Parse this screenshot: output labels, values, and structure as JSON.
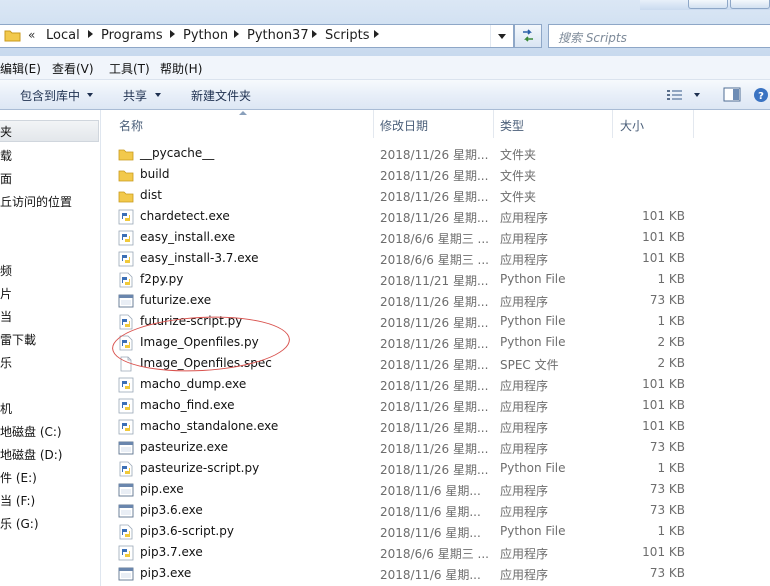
{
  "address": {
    "overflow": "«",
    "crumbs": [
      "Local",
      "Programs",
      "Python",
      "Python37",
      "Scripts"
    ]
  },
  "search": {
    "placeholder": "搜索 Scripts"
  },
  "menu": [
    "编辑(E)",
    "查看(V)",
    "工具(T)",
    "帮助(H)"
  ],
  "commands": {
    "include_library": "包含到库中",
    "share": "共享",
    "new_folder": "新建文件夹"
  },
  "nav": {
    "items": [
      "夹",
      "载",
      "面",
      "丘访问的位置",
      "频",
      "片",
      "当",
      "雷下載",
      "乐",
      "机",
      "地磁盘 (C:)",
      "地磁盘 (D:)",
      "件 (E:)",
      "当 (F:)",
      "乐 (G:)"
    ]
  },
  "columns": {
    "name": "名称",
    "date": "修改日期",
    "type": "类型",
    "size": "大小"
  },
  "files": [
    {
      "icon": "folder-icon",
      "name": "__pycache__",
      "date": "2018/11/26 星期...",
      "type": "文件夹",
      "size": ""
    },
    {
      "icon": "folder-icon",
      "name": "build",
      "date": "2018/11/26 星期...",
      "type": "文件夹",
      "size": ""
    },
    {
      "icon": "folder-icon",
      "name": "dist",
      "date": "2018/11/26 星期...",
      "type": "文件夹",
      "size": ""
    },
    {
      "icon": "python-exe-icon",
      "name": "chardetect.exe",
      "date": "2018/11/26 星期...",
      "type": "应用程序",
      "size": "101 KB"
    },
    {
      "icon": "python-exe-icon",
      "name": "easy_install.exe",
      "date": "2018/6/6 星期三 ...",
      "type": "应用程序",
      "size": "101 KB"
    },
    {
      "icon": "python-exe-icon",
      "name": "easy_install-3.7.exe",
      "date": "2018/6/6 星期三 ...",
      "type": "应用程序",
      "size": "101 KB"
    },
    {
      "icon": "python-file-icon",
      "name": "f2py.py",
      "date": "2018/11/21 星期...",
      "type": "Python File",
      "size": "1 KB"
    },
    {
      "icon": "app-exe-icon",
      "name": "futurize.exe",
      "date": "2018/11/26 星期...",
      "type": "应用程序",
      "size": "73 KB"
    },
    {
      "icon": "python-file-icon",
      "name": "futurize-script.py",
      "date": "2018/11/26 星期...",
      "type": "Python File",
      "size": "1 KB"
    },
    {
      "icon": "python-file-icon",
      "name": "Image_Openfiles.py",
      "date": "2018/11/26 星期...",
      "type": "Python File",
      "size": "2 KB"
    },
    {
      "icon": "blank-file-icon",
      "name": "Image_Openfiles.spec",
      "date": "2018/11/26 星期...",
      "type": "SPEC 文件",
      "size": "2 KB"
    },
    {
      "icon": "python-exe-icon",
      "name": "macho_dump.exe",
      "date": "2018/11/26 星期...",
      "type": "应用程序",
      "size": "101 KB"
    },
    {
      "icon": "python-exe-icon",
      "name": "macho_find.exe",
      "date": "2018/11/26 星期...",
      "type": "应用程序",
      "size": "101 KB"
    },
    {
      "icon": "python-exe-icon",
      "name": "macho_standalone.exe",
      "date": "2018/11/26 星期...",
      "type": "应用程序",
      "size": "101 KB"
    },
    {
      "icon": "app-exe-icon",
      "name": "pasteurize.exe",
      "date": "2018/11/26 星期...",
      "type": "应用程序",
      "size": "73 KB"
    },
    {
      "icon": "python-file-icon",
      "name": "pasteurize-script.py",
      "date": "2018/11/26 星期...",
      "type": "Python File",
      "size": "1 KB"
    },
    {
      "icon": "app-exe-icon",
      "name": "pip.exe",
      "date": "2018/11/6 星期...",
      "type": "应用程序",
      "size": "73 KB"
    },
    {
      "icon": "app-exe-icon",
      "name": "pip3.6.exe",
      "date": "2018/11/6 星期...",
      "type": "应用程序",
      "size": "73 KB"
    },
    {
      "icon": "python-file-icon",
      "name": "pip3.6-script.py",
      "date": "2018/11/6 星期...",
      "type": "Python File",
      "size": "1 KB"
    },
    {
      "icon": "python-exe-icon",
      "name": "pip3.7.exe",
      "date": "2018/6/6 星期三 ...",
      "type": "应用程序",
      "size": "101 KB"
    },
    {
      "icon": "app-exe-icon",
      "name": "pip3.exe",
      "date": "2018/11/6 星期...",
      "type": "应用程序",
      "size": "73 KB"
    }
  ],
  "colors": {
    "folder": "#f2c94c",
    "python_blue": "#3b6fb6",
    "python_yellow": "#f0c93a",
    "annotation": "#d9534f",
    "header_text": "#4c607a"
  }
}
